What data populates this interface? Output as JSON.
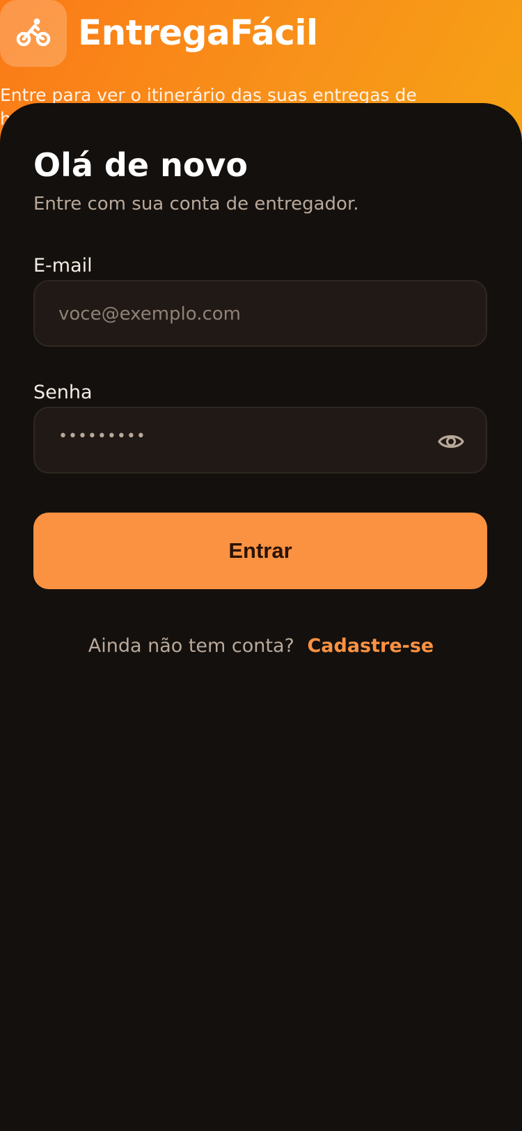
{
  "header": {
    "app_name": "EntregaFácil",
    "tagline": "Entre para ver o itinerário das suas entregas de hoje.",
    "logo_icon": "bicycle-icon"
  },
  "login": {
    "title": "Olá de novo",
    "subtitle": "Entre com sua conta de entregador.",
    "email": {
      "label": "E-mail",
      "placeholder": "voce@exemplo.com",
      "value": ""
    },
    "password": {
      "label": "Senha",
      "masked_value": "•••••••••",
      "toggle_icon": "eye-icon"
    },
    "submit_label": "Entrar",
    "signup_prompt": "Ainda não tem conta?",
    "signup_link": "Cadastre-se"
  },
  "colors": {
    "accent": "#fb9242",
    "background": "#14100d",
    "hero_gradient_start": "#fb7a17",
    "hero_gradient_end": "#f6a313"
  }
}
